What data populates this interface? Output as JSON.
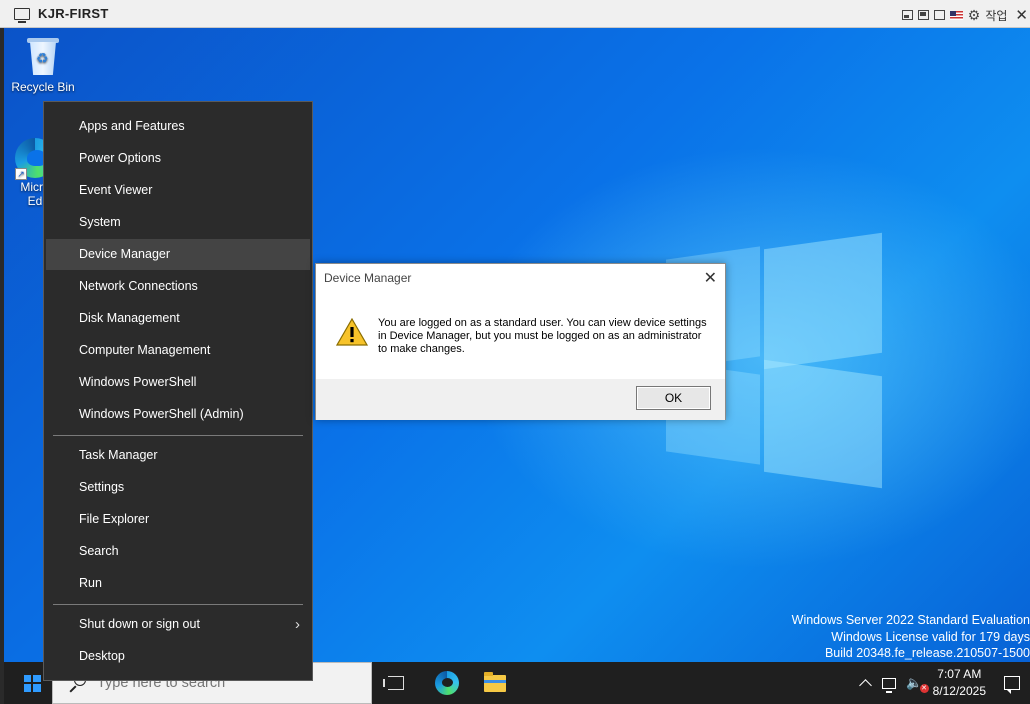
{
  "rdp": {
    "title": "KJR-FIRST",
    "controls_label": "작업",
    "icons": [
      "monitor-icon",
      "restore-icon",
      "window-icon",
      "fullscreen-icon",
      "flag-icon",
      "gear-icon",
      "close-icon"
    ]
  },
  "desktop": {
    "recycle_bin_label": "Recycle Bin",
    "edge_label_line1": "Micro",
    "edge_label_line2": "Ed"
  },
  "watermark": {
    "line1": "Windows Server 2022 Standard Evaluation",
    "line2": "Windows License valid for 179 days",
    "line3": "Build 20348.fe_release.210507-1500"
  },
  "winx_menu": {
    "items": [
      "Apps and Features",
      "Power Options",
      "Event Viewer",
      "System",
      "Device Manager",
      "Network Connections",
      "Disk Management",
      "Computer Management",
      "Windows PowerShell",
      "Windows PowerShell (Admin)",
      "Task Manager",
      "Settings",
      "File Explorer",
      "Search",
      "Run",
      "Shut down or sign out",
      "Desktop"
    ],
    "highlighted": "Device Manager"
  },
  "dialog": {
    "title": "Device Manager",
    "message": "You are logged on as a standard user. You can view device settings in Device Manager, but you must be logged on as an administrator to make changes.",
    "ok_label": "OK"
  },
  "taskbar": {
    "search_placeholder": "Type here to search",
    "time": "7:07 AM",
    "date": "8/12/2025"
  },
  "colors": {
    "desktop": "#0a72e8",
    "menu_bg": "#2b2b2b",
    "menu_highlight": "#444444",
    "taskbar": "#1f1f1f",
    "start_logo": "#2f9bff"
  }
}
